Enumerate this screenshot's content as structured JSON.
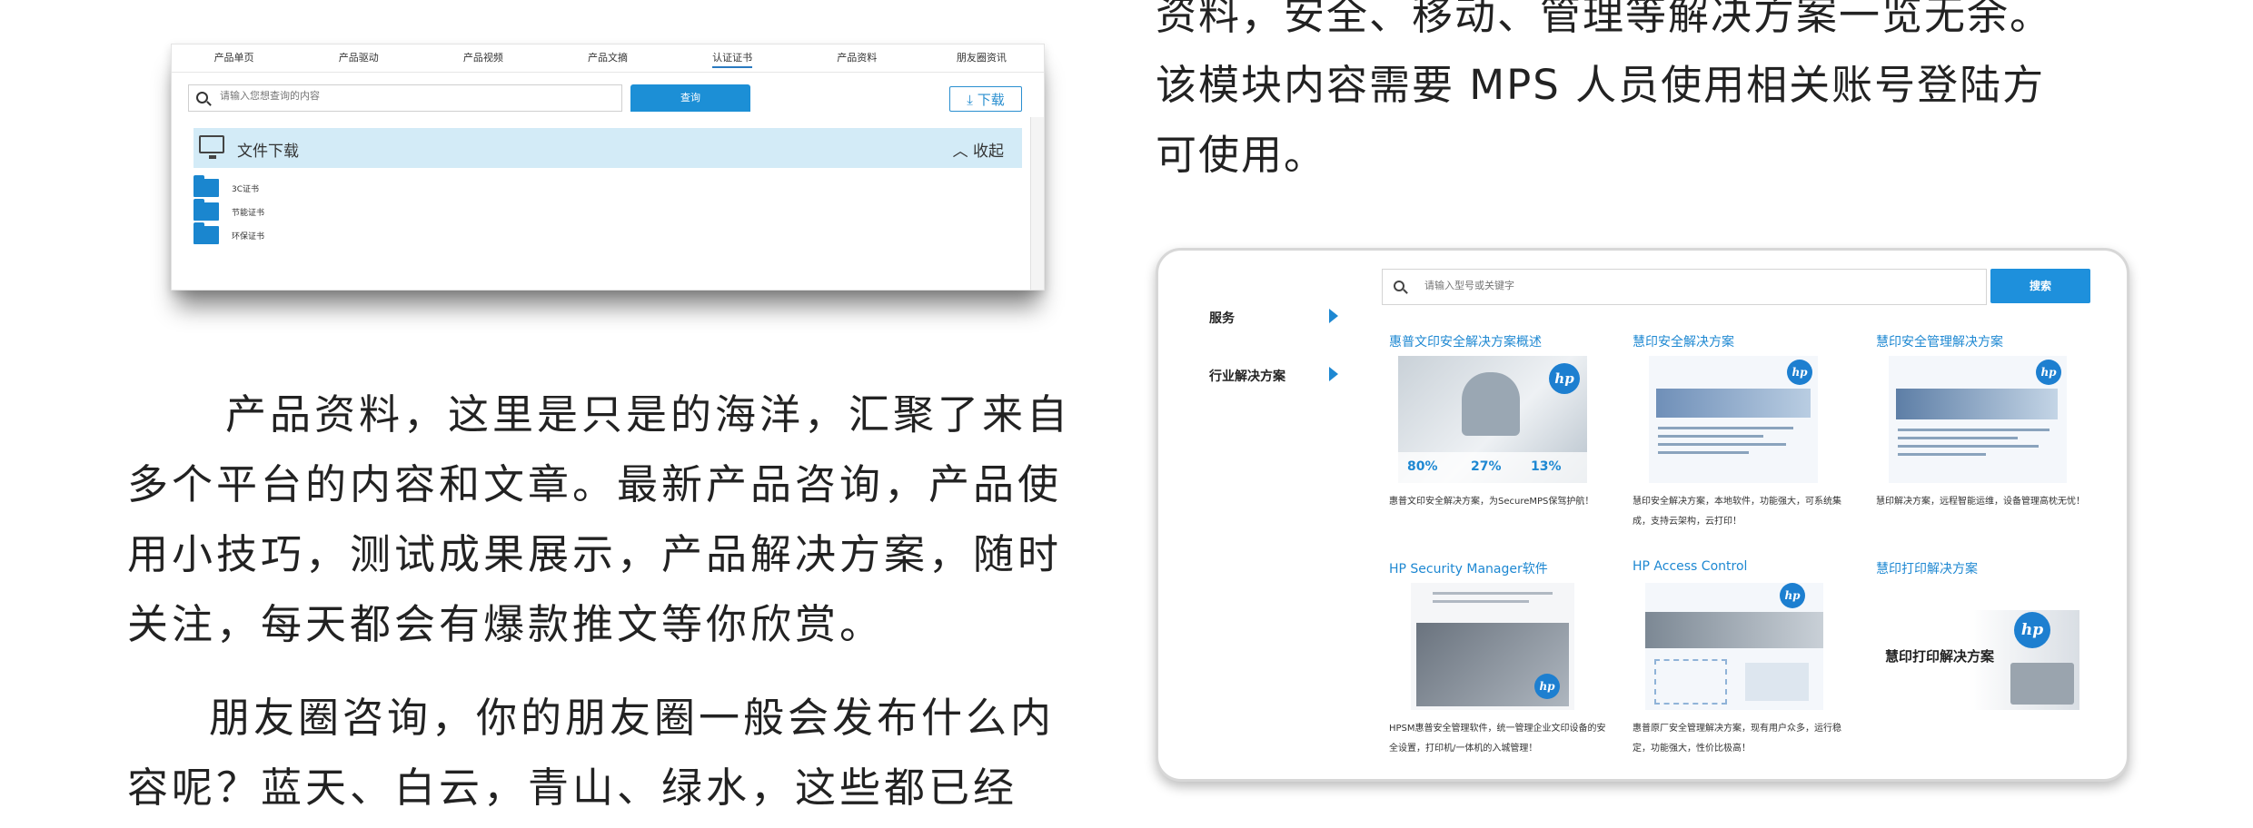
{
  "file_panel": {
    "tabs": [
      "产品单页",
      "产品驱动",
      "产品视频",
      "产品文摘",
      "认证证书",
      "产品资料",
      "朋友圈资讯"
    ],
    "active_tab": 4,
    "search_placeholder": "请输入您想查询的内容",
    "query_button": "查询",
    "download_button": "下载",
    "section_title": "文件下载",
    "collapse_label": "收起",
    "folders": [
      "3C证书",
      "节能证书",
      "环保证书"
    ]
  },
  "paragraphs": {
    "right_top": [
      "资料，安全、移动、管理等解决方案一览无余。",
      "该模块内容需要 MPS 人员使用相关账号登陆方",
      "可使用。"
    ],
    "left_products": [
      "产品资料，这里是只是的海洋，汇聚了来自",
      "多个平台的内容和文章。最新产品咨询，产品使",
      "用小技巧，测试成果展示，产品解决方案，随时",
      "关注，每天都会有爆款推文等你欣赏。"
    ],
    "left_moments": [
      "朋友圈咨询，你的朋友圈一般会发布什么内",
      "容呢？蓝天、白云，青山、绿水，这些都已经"
    ]
  },
  "solutions_panel": {
    "search_placeholder": "请输入型号或关键字",
    "search_button": "搜索",
    "sidebar": [
      "服务",
      "行业解决方案"
    ],
    "hp_logo_text": "hp",
    "cards": [
      {
        "title": "惠普文印安全解决方案概述",
        "desc": "惠普文印安全解决方案，为SecureMPS保驾护航！",
        "stats": [
          "80%",
          "27%",
          "13%"
        ]
      },
      {
        "title": "慧印安全解决方案",
        "desc": "慧印安全解决方案，本地软件，功能强大，可系统集成，支持云架构，云打印！"
      },
      {
        "title": "慧印安全管理解决方案",
        "desc": "慧印解决方案，远程智能运维，设备管理高枕无忧！"
      },
      {
        "title": "HP Security Manager软件",
        "desc": "HPSM惠普安全管理软件，统一管理企业文印设备的安全设置，打印机/一体机的入城管理！"
      },
      {
        "title": "HP Access Control",
        "desc": "惠普原厂安全管理解决方案，现有用户众多，运行稳定，功能强大，性价比极高！"
      },
      {
        "title": "慧印打印解决方案",
        "desc": "",
        "thumb_caption": "慧印打印解决方案"
      }
    ]
  },
  "colors": {
    "accent": "#1e88d2",
    "button": "#1e90dc",
    "panel_bar": "#d3ebf7",
    "folder": "#1a86cf"
  }
}
